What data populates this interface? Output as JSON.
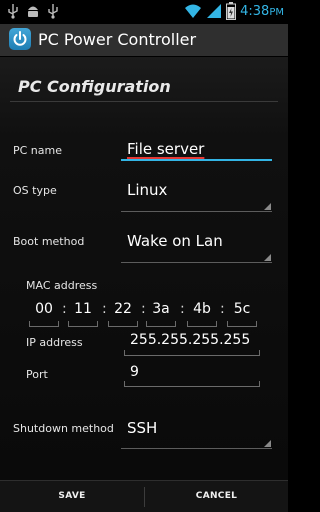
{
  "status_bar": {
    "time": "4:38",
    "time_suffix": "PM",
    "notification_icons": [
      "usb-icon",
      "android-debug-icon",
      "usb-icon"
    ],
    "system_icons": [
      "wifi-icon",
      "signal-icon",
      "battery-icon"
    ]
  },
  "action_bar": {
    "title": "PC Power Controller",
    "icon": "power-icon"
  },
  "section": {
    "title": "PC Configuration"
  },
  "form": {
    "pc_name": {
      "label": "PC name",
      "value": "File server"
    },
    "os_type": {
      "label": "OS type",
      "value": "Linux"
    },
    "boot_method": {
      "label": "Boot method",
      "value": "Wake on Lan"
    },
    "mac_address": {
      "label": "MAC address",
      "octets": [
        "00",
        "11",
        "22",
        "3a",
        "4b",
        "5c"
      ],
      "separator": ":"
    },
    "ip_address": {
      "label": "IP address",
      "value": "255.255.255.255"
    },
    "port": {
      "label": "Port",
      "value": "9"
    },
    "shutdown_method": {
      "label": "Shutdown method",
      "value": "SSH"
    }
  },
  "buttons": {
    "save": "SAVE",
    "cancel": "CANCEL"
  },
  "colors": {
    "accent": "#33b5e5",
    "action_bar": "#2f2f2f",
    "spell_error": "#e53935"
  }
}
